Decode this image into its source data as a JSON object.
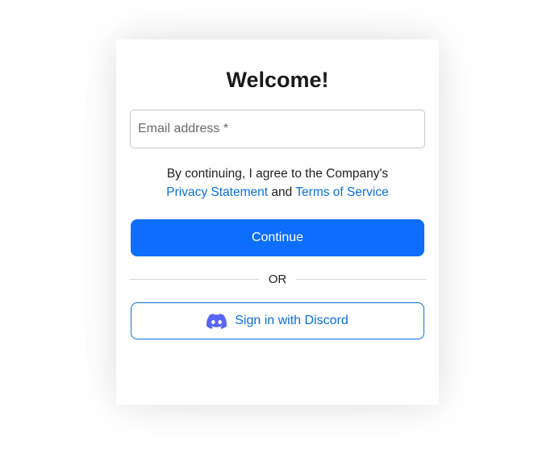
{
  "login": {
    "title": "Welcome!",
    "email_placeholder": "Email address *",
    "email_value": "",
    "consent_prefix": "By continuing, I agree to the Company's",
    "privacy_link": "Privacy Statement",
    "consent_and": "and",
    "terms_link": "Terms of Service",
    "continue_label": "Continue",
    "divider_label": "OR",
    "discord_label": "Sign in with Discord",
    "discord_icon": "discord-logo-icon"
  },
  "colors": {
    "primary": "#0d6efd",
    "link": "#0a6fde",
    "discord_brand": "#5865F2",
    "text": "#1f1f1f"
  }
}
